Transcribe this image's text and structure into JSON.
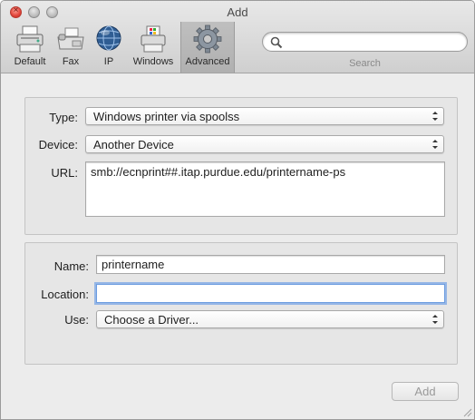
{
  "window": {
    "title": "Add"
  },
  "toolbar": {
    "items": [
      {
        "label": "Default",
        "icon": "default-printer-icon"
      },
      {
        "label": "Fax",
        "icon": "fax-icon"
      },
      {
        "label": "IP",
        "icon": "globe-icon"
      },
      {
        "label": "Windows",
        "icon": "windows-printer-icon"
      },
      {
        "label": "Advanced",
        "icon": "gear-icon",
        "selected": true
      }
    ],
    "search": {
      "value": "",
      "placeholder": "",
      "label": "Search"
    }
  },
  "form": {
    "type": {
      "label": "Type:",
      "value": "Windows printer via spoolss"
    },
    "device": {
      "label": "Device:",
      "value": "Another Device"
    },
    "url": {
      "label": "URL:",
      "value": "smb://ecnprint##.itap.purdue.edu/printername-ps"
    },
    "name": {
      "label": "Name:",
      "value": "printername"
    },
    "location": {
      "label": "Location:",
      "value": ""
    },
    "use": {
      "label": "Use:",
      "value": "Choose a Driver..."
    }
  },
  "add_button": {
    "label": "Add",
    "enabled": false
  },
  "colors": {
    "focus_ring": "#6d9de0",
    "close_button": "#e0443a",
    "disabled_text": "#9a9a9a"
  }
}
